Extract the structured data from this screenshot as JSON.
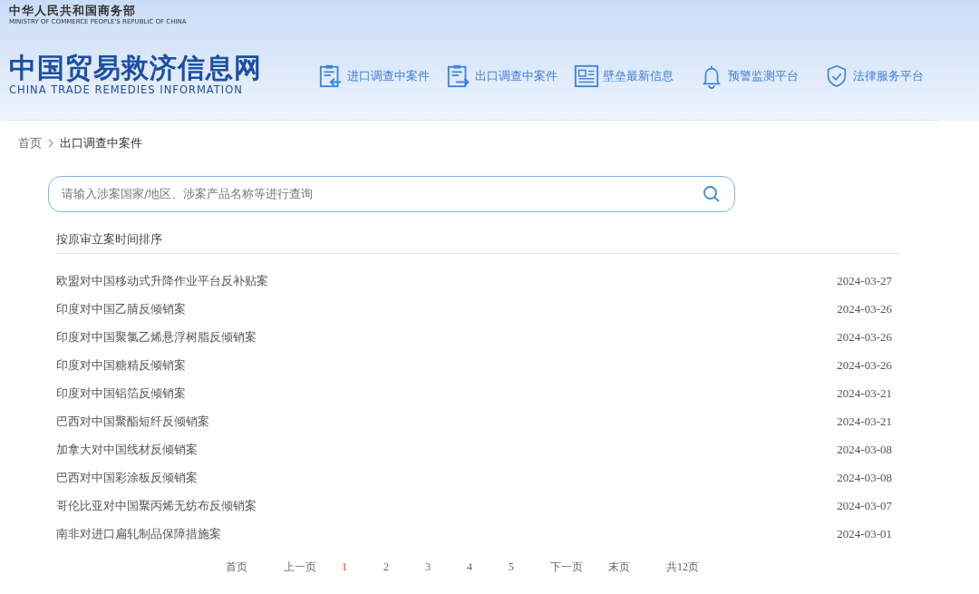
{
  "header": {
    "ministry_cn": "中华人民共和国商务部",
    "ministry_en": "MINISTRY OF COMMERCE PEOPLE'S REPUBLIC OF CHINA",
    "site_title": "中国贸易救济信息网",
    "site_subtitle": "CHINA TRADE REMEDIES INFORMATION"
  },
  "nav": [
    {
      "kind": "import",
      "label": "进口调查中案件"
    },
    {
      "kind": "export",
      "label": "出口调查中案件"
    },
    {
      "kind": "news",
      "label": "壁垒最新信息"
    },
    {
      "kind": "alert",
      "label": "预警监测平台"
    },
    {
      "kind": "legal",
      "label": "法律服务平台"
    }
  ],
  "breadcrumb": [
    "首页",
    "出口调查中案件"
  ],
  "search": {
    "placeholder": "请输入涉案国家/地区、涉案产品名称等进行查询"
  },
  "sort_label": "按原审立案时间排序",
  "cases": [
    {
      "title": "欧盟对中国移动式升降作业平台反补贴案",
      "date": "2024-03-27"
    },
    {
      "title": "印度对中国乙腈反倾销案",
      "date": "2024-03-26"
    },
    {
      "title": "印度对中国聚氯乙烯悬浮树脂反倾销案",
      "date": "2024-03-26"
    },
    {
      "title": "印度对中国糖精反倾销案",
      "date": "2024-03-26"
    },
    {
      "title": "印度对中国铝箔反倾销案",
      "date": "2024-03-21"
    },
    {
      "title": "巴西对中国聚酯短纤反倾销案",
      "date": "2024-03-21"
    },
    {
      "title": "加拿大对中国线材反倾销案",
      "date": "2024-03-08"
    },
    {
      "title": "巴西对中国彩涂板反倾销案",
      "date": "2024-03-08"
    },
    {
      "title": "哥伦比亚对中国聚丙烯无纺布反倾销案",
      "date": "2024-03-07"
    },
    {
      "title": "南非对进口扁轧制品保障措施案",
      "date": "2024-03-01"
    }
  ],
  "pager": [
    {
      "kind": "nav",
      "label": "首页",
      "selected": false
    },
    {
      "kind": "nav",
      "label": "上一页",
      "selected": false
    },
    {
      "kind": "page",
      "label": "1",
      "selected": true
    },
    {
      "kind": "page",
      "label": "2",
      "selected": false
    },
    {
      "kind": "page",
      "label": "3",
      "selected": false
    },
    {
      "kind": "page",
      "label": "4",
      "selected": false
    },
    {
      "kind": "page",
      "label": "5",
      "selected": false
    },
    {
      "kind": "nav",
      "label": "下一页",
      "selected": false
    },
    {
      "kind": "nav",
      "label": "末页",
      "selected": false
    },
    {
      "kind": "total",
      "label": "共12页"
    }
  ]
}
